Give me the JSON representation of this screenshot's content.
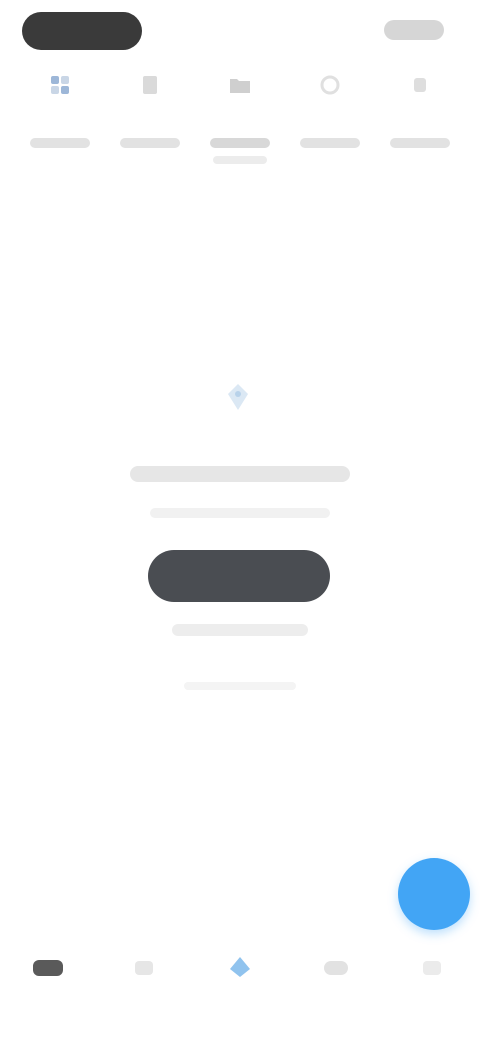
{
  "status_bar": {},
  "tabs": [
    {
      "label": "",
      "icon": "grid-icon"
    },
    {
      "label": "",
      "icon": "file-icon"
    },
    {
      "label": "",
      "icon": "folder-icon",
      "active": true
    },
    {
      "label": "",
      "icon": "clock-icon"
    },
    {
      "label": "",
      "icon": "more-icon"
    }
  ],
  "empty_state": {
    "icon": "tag-icon",
    "title": "",
    "button_label": ""
  },
  "fab": {
    "icon": "plus-icon"
  },
  "bottom_nav": [
    {
      "label": "",
      "icon": "home-icon"
    },
    {
      "label": "",
      "icon": "list-icon"
    },
    {
      "label": "",
      "icon": "location-icon",
      "active": true
    },
    {
      "label": "",
      "icon": "chat-icon"
    },
    {
      "label": "",
      "icon": "profile-icon"
    }
  ],
  "colors": {
    "accent": "#42a5f5",
    "button": "#4a4d52",
    "placeholder": "#e6e6e6"
  }
}
